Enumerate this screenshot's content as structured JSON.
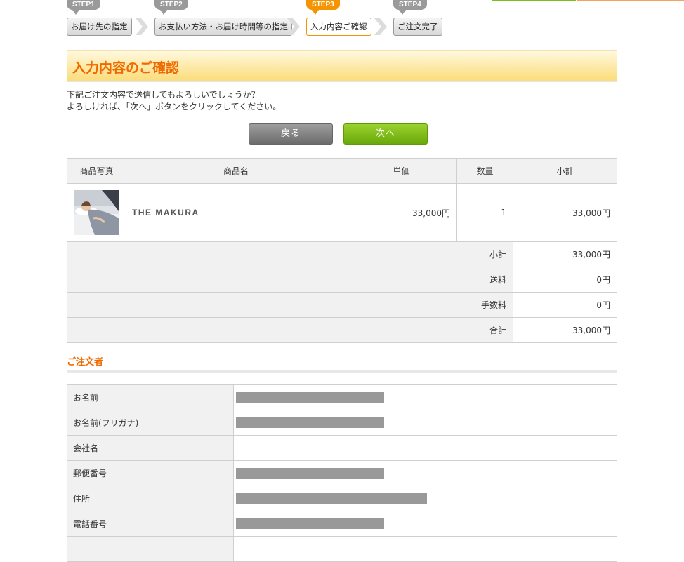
{
  "steps": [
    {
      "badge": "STEP1",
      "label": "お届け先の指定"
    },
    {
      "badge": "STEP2",
      "label": "お支払い方法・お届け時間等の指定"
    },
    {
      "badge": "STEP3",
      "label": "入力内容ご確認"
    },
    {
      "badge": "STEP4",
      "label": "ご注文完了"
    }
  ],
  "heading": "入力内容のご確認",
  "intro": {
    "line1": "下記ご注文内容で送信してもよろしいでしょうか？",
    "line2": "よろしければ、「次へ」ボタンをクリックしてください。"
  },
  "buttons": {
    "back": "戻る",
    "next": "次へ"
  },
  "order_table": {
    "headers": [
      "商品写真",
      "商品名",
      "単価",
      "数量",
      "小計"
    ],
    "items": [
      {
        "name": "THE MAKURA",
        "price": "33,000円",
        "qty": "1",
        "subtotal": "33,000円"
      }
    ],
    "summary": [
      {
        "label": "小計",
        "value": "33,000円"
      },
      {
        "label": "送料",
        "value": "0円"
      },
      {
        "label": "手数料",
        "value": "0円"
      },
      {
        "label": "合計",
        "value": "33,000円"
      }
    ]
  },
  "orderer": {
    "title": "ご注文者",
    "rows": [
      "お名前",
      "お名前(フリガナ)",
      "会社名",
      "郵便番号",
      "住所",
      "電話番号"
    ]
  },
  "colors": {
    "accent": "#f06a00",
    "active_step": "#f39400",
    "next_button": "#7bbd1a"
  }
}
